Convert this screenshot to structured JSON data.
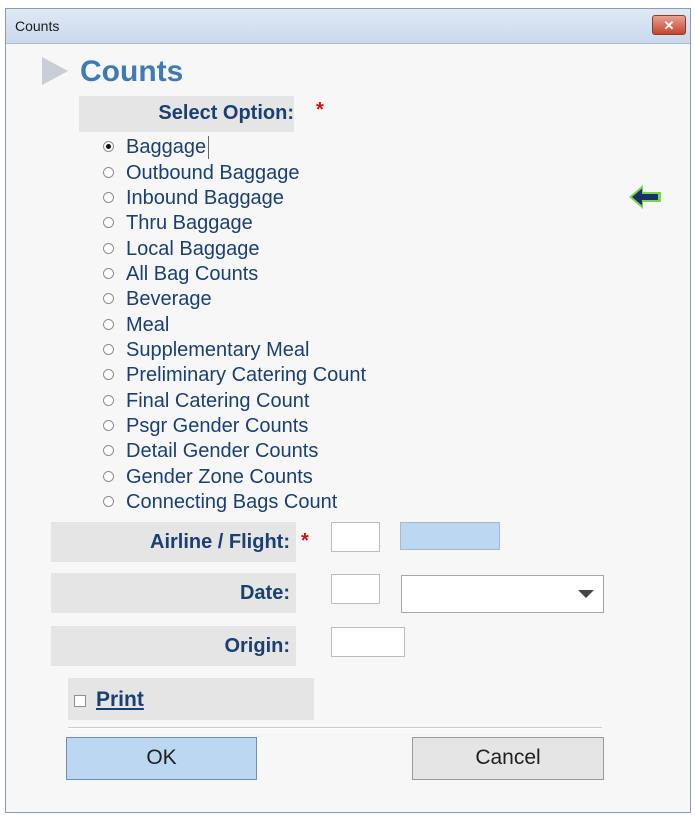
{
  "window": {
    "title": "Counts",
    "close_glyph": "✕"
  },
  "header": {
    "title": "Counts",
    "icon": "chevron-right-arrow"
  },
  "select_option": {
    "label": "Select Option:",
    "required_mark": "*",
    "options": [
      {
        "label": "Baggage",
        "selected": true
      },
      {
        "label": "Outbound Baggage",
        "selected": false
      },
      {
        "label": "Inbound Baggage",
        "selected": false
      },
      {
        "label": "Thru Baggage",
        "selected": false
      },
      {
        "label": "Local Baggage",
        "selected": false
      },
      {
        "label": "All Bag Counts",
        "selected": false
      },
      {
        "label": "Beverage",
        "selected": false
      },
      {
        "label": "Meal",
        "selected": false
      },
      {
        "label": "Supplementary Meal",
        "selected": false
      },
      {
        "label": "Preliminary Catering Count",
        "selected": false
      },
      {
        "label": "Final Catering Count",
        "selected": false
      },
      {
        "label": "Psgr Gender Counts",
        "selected": false
      },
      {
        "label": "Detail Gender Counts",
        "selected": false
      },
      {
        "label": "Gender Zone Counts",
        "selected": false
      },
      {
        "label": "Connecting Bags Count",
        "selected": false
      }
    ]
  },
  "airline_flight": {
    "label": "Airline / Flight:",
    "required_mark": "*",
    "airline_value": "",
    "flight_value": ""
  },
  "date": {
    "label": "Date:",
    "day_value": "",
    "selected_value": ""
  },
  "origin": {
    "label": "Origin:",
    "value": ""
  },
  "print": {
    "label": "Print",
    "checked": false
  },
  "buttons": {
    "ok": "OK",
    "cancel": "Cancel"
  },
  "colors": {
    "accent": "#3f7ab8",
    "label_text": "#1a3f74",
    "required": "#cc1111",
    "input_highlight": "#bcd7f1",
    "arrow_green": "#79d64a",
    "arrow_navy": "#1c2f6b"
  }
}
